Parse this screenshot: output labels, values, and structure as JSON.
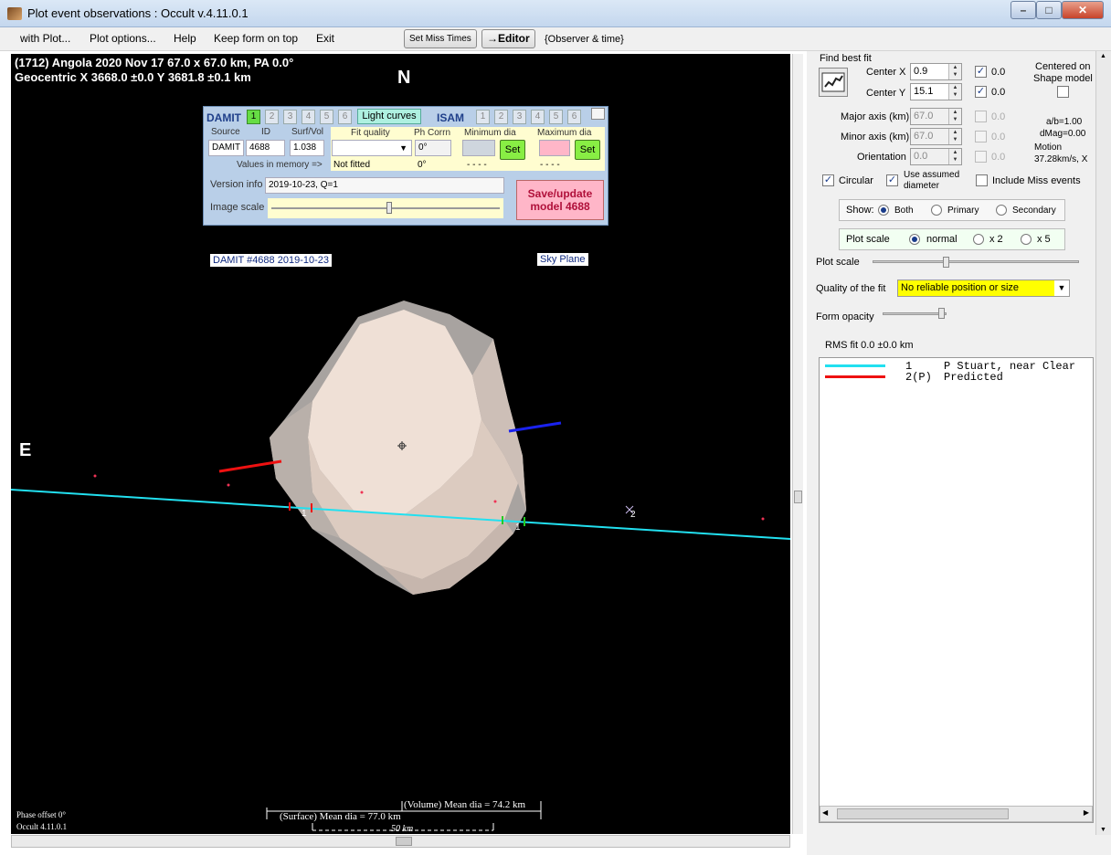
{
  "window": {
    "title": "Plot event observations : Occult v.4.11.0.1",
    "minimize": "–",
    "maximize": "□",
    "close": "✕"
  },
  "menu": {
    "items": [
      "with Plot...",
      "Plot options...",
      "Help",
      "Keep form on top",
      "Exit"
    ],
    "set_miss_times": "Set Miss Times",
    "editor": "→Editor",
    "observer_time": "{Observer & time}"
  },
  "plot": {
    "header_line1": "(1712) Angola  2020 Nov 17  67.0 x 67.0 km, PA 0.0°",
    "header_line2": "Geocentric  X  3668.0 ±0.0  Y 3681.8 ±0.1 km",
    "north": "N",
    "east": "E",
    "damit_label": "DAMIT #4688 2019-10-23",
    "sky_plane": "Sky Plane",
    "chord1_label_a": "1",
    "chord1_label_b": "1",
    "chord2_label": "2",
    "volume_mean": "(Volume) Mean dia = 74.2 km",
    "surface_mean": "(Surface) Mean dia = 77.0 km",
    "scale_bar": "50 km",
    "phase_offset": "Phase offset 0°",
    "version": "Occult 4.11.0.1",
    "colors": {
      "chord1": "#22e0f0",
      "chord2_red": "#ee1111",
      "blue_marker": "#1a22ee"
    }
  },
  "damit_panel": {
    "damit_title": "DAMIT",
    "damit_nums": [
      "1",
      "2",
      "3",
      "4",
      "5",
      "6"
    ],
    "light_curves": "Light curves",
    "isam_title": "ISAM",
    "isam_nums": [
      "1",
      "2",
      "3",
      "4",
      "5",
      "6"
    ],
    "col_source": "Source",
    "col_id": "ID",
    "col_surfvol": "Surf/Vol",
    "col_fit_quality": "Fit quality",
    "col_ph_corrn": "Ph Corrn",
    "col_min_dia": "Minimum dia",
    "col_max_dia": "Maximum dia",
    "source": "DAMIT",
    "id": "4688",
    "surfvol": "1.038",
    "ph_corrn": "0°",
    "set_min": "Set",
    "set_max": "Set",
    "values_in_memory": "Values in memory =>",
    "mem_fit": "Not fitted",
    "mem_phase": "0°",
    "mem_min": "- - - -",
    "mem_max": "- - - -",
    "version_info_label": "Version info",
    "version_info": "2019-10-23, Q=1",
    "image_scale_label": "Image scale",
    "save_line1": "Save/update",
    "save_line2": "model 4688"
  },
  "right_panel": {
    "find_best_fit": "Find best fit",
    "center_x_label": "Center X",
    "center_x": "0.9",
    "center_x_chk": "0.0",
    "center_y_label": "Center Y",
    "center_y": "15.1",
    "center_y_chk": "0.0",
    "centered_on": "Centered on",
    "shape_model": "Shape model",
    "major_axis_label": "Major axis (km)",
    "major_axis": "67.0",
    "major_chk": "0.0",
    "minor_axis_label": "Minor axis (km)",
    "minor_axis": "67.0",
    "minor_chk": "0.0",
    "orientation_label": "Orientation",
    "orientation": "0.0",
    "orient_chk": "0.0",
    "ab_ratio": "a/b=1.00",
    "dmag": "dMag=0.00",
    "motion": "Motion",
    "motion_val": "37.28km/s, X",
    "circular": "Circular",
    "use_assumed_1": "Use assumed",
    "use_assumed_2": "diameter",
    "include_miss": "Include Miss events",
    "show_label": "Show:",
    "show_both": "Both",
    "show_primary": "Primary",
    "show_secondary": "Secondary",
    "plot_scale_label": "Plot scale",
    "scale_normal": "normal",
    "scale_x2": "x 2",
    "scale_x5": "x 5",
    "plot_scale_slider": "Plot scale",
    "quality_label": "Quality of the fit",
    "quality_value": "No reliable position or size",
    "form_opacity": "Form opacity",
    "rms_fit": "RMS fit 0.0 ±0.0 km",
    "legend": [
      {
        "num": "1",
        "text": "P Stuart, near Clear",
        "color": "#22e0f0"
      },
      {
        "num": "2(P)",
        "text": "Predicted",
        "color": "#ee1111"
      }
    ]
  }
}
